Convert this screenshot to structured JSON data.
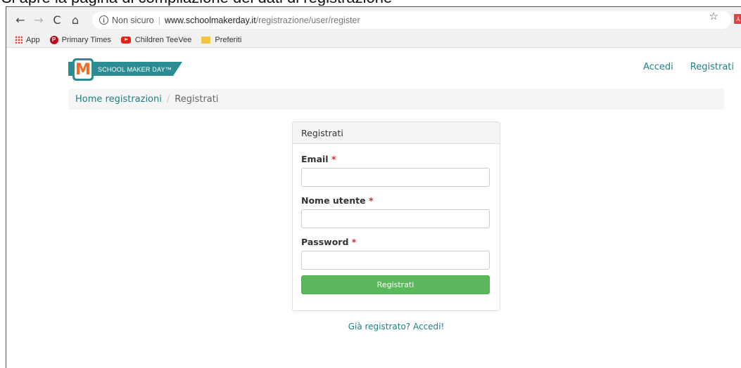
{
  "caption": "Si apre la pagina di compilazione dei dati di registrazione",
  "browser": {
    "nav": {
      "back": "←",
      "forward": "→",
      "reload": "C",
      "home": "⌂"
    },
    "address": {
      "security_label": "Non sicuro",
      "separator": "|",
      "host": "www.schoolmakerday.it",
      "path": "/registrazione/user/register"
    },
    "star": "☆",
    "bookmarks": [
      {
        "label": "App"
      },
      {
        "label": "Primary Times"
      },
      {
        "label": "Children TeeVee"
      },
      {
        "label": "Preferiti"
      }
    ]
  },
  "header": {
    "logo_letter": "M",
    "logo_text": "SCHOOL MAKER DAY™",
    "links": {
      "login": "Accedi",
      "register": "Registrati"
    }
  },
  "breadcrumb": {
    "home": "Home registrazioni",
    "separator": "/",
    "current": "Registrati"
  },
  "form": {
    "title": "Registrati",
    "fields": {
      "email": {
        "label": "Email",
        "required_mark": "*",
        "value": ""
      },
      "username": {
        "label": "Nome utente",
        "required_mark": "*",
        "value": ""
      },
      "password": {
        "label": "Password",
        "required_mark": "*",
        "value": ""
      }
    },
    "submit_label": "Registrati",
    "login_prompt": "Già registrato? Accedi!"
  },
  "colors": {
    "brand_teal": "#2b8c93",
    "link": "#1d7f86",
    "logo_orange": "#f26b21",
    "submit_green": "#5cb85c",
    "required_red": "#c9302c"
  }
}
